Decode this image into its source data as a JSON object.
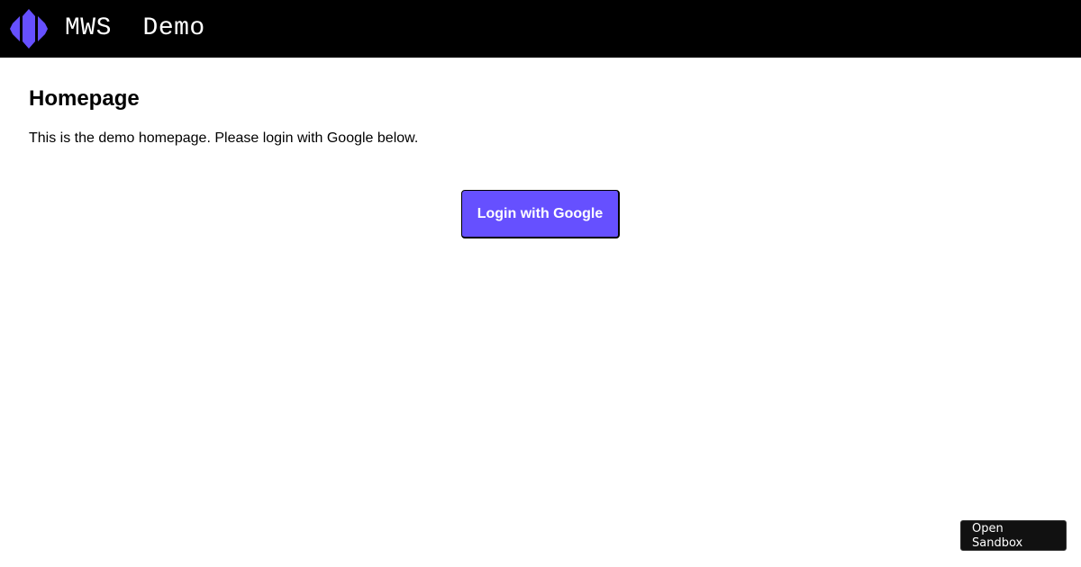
{
  "header": {
    "title": "MWS  Demo",
    "logo_icon": "shield-emblem-icon",
    "background": "#000000"
  },
  "main": {
    "page_title": "Homepage",
    "description": "This is the demo homepage. Please login with Google below.",
    "login_button_label": "Login with Google"
  },
  "sandbox": {
    "line1": "Open",
    "line2": "Sandbox"
  },
  "colors": {
    "accent": "#6650ff",
    "header_bg": "#000000",
    "sandbox_bg": "#111111"
  }
}
